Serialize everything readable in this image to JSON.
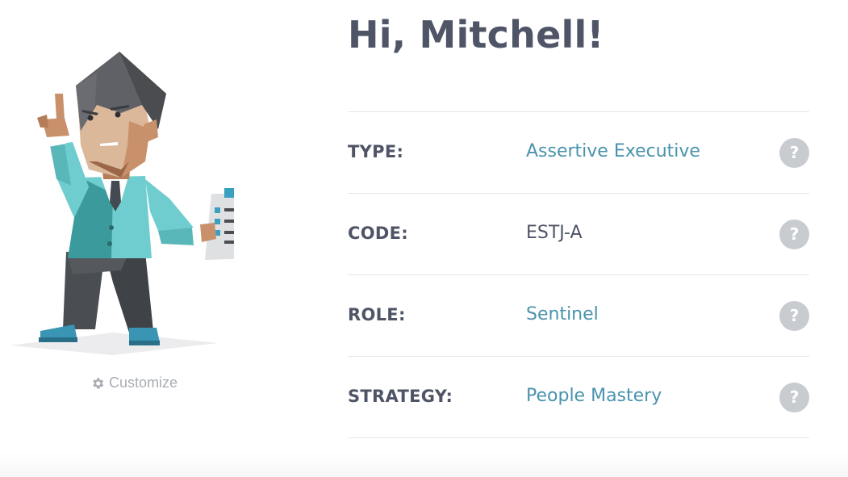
{
  "greeting": "Hi, Mitchell!",
  "avatar": {
    "icon": "executive-avatar-illustration",
    "customize_label": "Customize",
    "customize_icon": "gear-icon"
  },
  "profile": {
    "rows": [
      {
        "label": "TYPE:",
        "value": "Assertive Executive",
        "value_is_link": true,
        "help": "?"
      },
      {
        "label": "CODE:",
        "value": "ESTJ-A",
        "value_is_link": false,
        "help": "?"
      },
      {
        "label": "ROLE:",
        "value": "Sentinel",
        "value_is_link": true,
        "help": "?"
      },
      {
        "label": "STRATEGY:",
        "value": "People Mastery",
        "value_is_link": true,
        "help": "?"
      }
    ]
  },
  "colors": {
    "heading": "#4f5567",
    "link": "#4a93ad",
    "help_bg": "#c8cbd0",
    "divider": "#e3e5e8",
    "muted": "#a9adb3"
  }
}
